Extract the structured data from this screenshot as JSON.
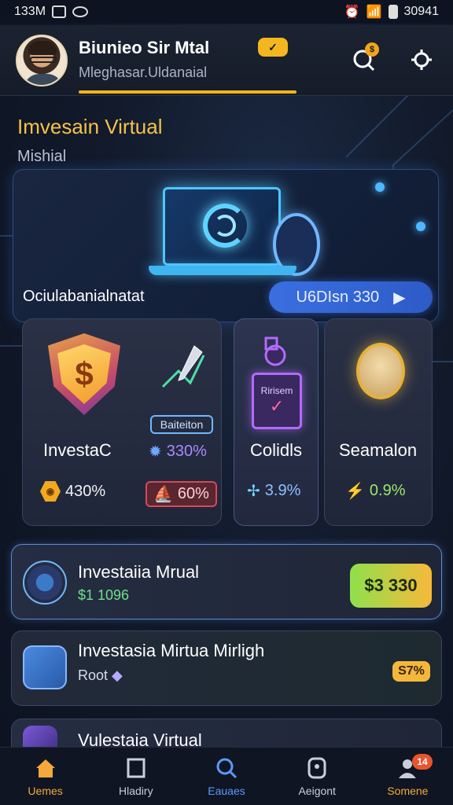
{
  "status_bar": {
    "time": "133M",
    "battery_text": "30941"
  },
  "header": {
    "user_name": "Biunieo Sir Mtal",
    "user_subtitle": "Mleghasar.Uldanaial"
  },
  "page": {
    "title": "Imvesain Virtual",
    "subtitle": "Mishial"
  },
  "hero": {
    "label": "Ociulabanialnatat",
    "button_label": "U6DIsn 330"
  },
  "cards": [
    {
      "title": "InvestaC",
      "stat_left": "430%",
      "stat_right": "330%",
      "stat_badge": "60%",
      "tag": "Baiteiton"
    },
    {
      "title": "Colidls",
      "stat": "3.9%",
      "emblem": "Ririsem"
    },
    {
      "title": "Seamalon",
      "stat": "0.9%"
    }
  ],
  "list": [
    {
      "title": "Investaiia Mrual",
      "sub": "$1 1096",
      "price": "$3 330"
    },
    {
      "title": "Investasia Mirtua Mirligh",
      "sub": "Root",
      "badge": "S7%"
    },
    {
      "title": "Vulestaia Virtual"
    }
  ],
  "nav": [
    {
      "label": "Uemes",
      "icon": "home-icon",
      "active": true
    },
    {
      "label": "Hladiry",
      "icon": "book-icon"
    },
    {
      "label": "Eauaes",
      "icon": "search-icon"
    },
    {
      "label": "Aeigont",
      "icon": "tag-icon"
    },
    {
      "label": "Somene",
      "icon": "user-icon",
      "badge": "14"
    }
  ],
  "colors": {
    "accent": "#f4c24a",
    "primary": "#3a6fe0",
    "background": "#121a2b"
  }
}
